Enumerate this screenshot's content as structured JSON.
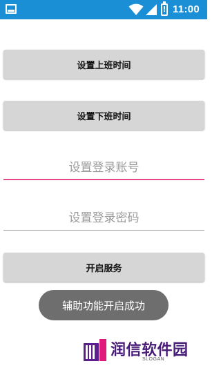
{
  "status_bar": {
    "time": "11:00",
    "battery_glyph": "!",
    "icons": [
      "notification-icon",
      "wifi-icon",
      "cellular-icon",
      "battery-icon"
    ],
    "background": "#1b8fd6"
  },
  "buttons": {
    "set_start_time": "设置上班时间",
    "set_end_time": "设置下班时间",
    "start_service": "开启服务"
  },
  "inputs": {
    "account_placeholder": "设置登录账号",
    "password_placeholder": "设置登录密码",
    "focused_underline_color": "#e8468c"
  },
  "toast": {
    "message": "辅助功能开启成功"
  },
  "watermark": {
    "brand": "润信软件园",
    "slogan": "SLOGAN"
  }
}
